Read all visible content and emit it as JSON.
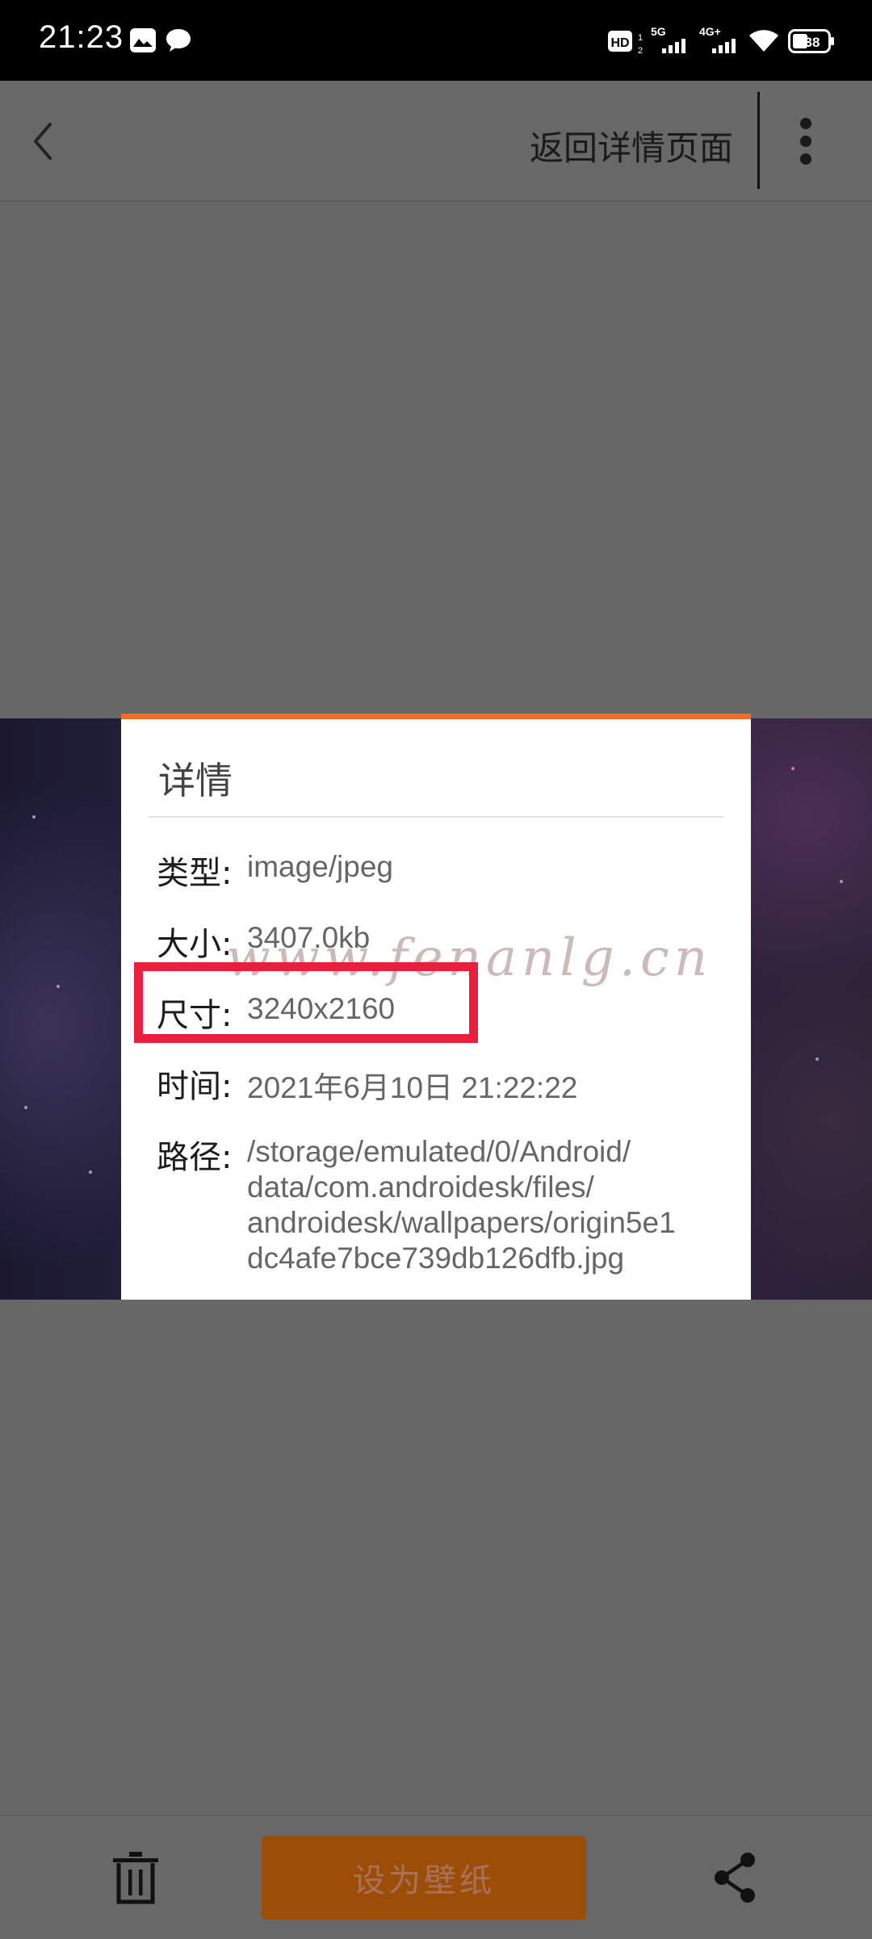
{
  "status_bar": {
    "time": "21:23",
    "left_icons": [
      "gallery-icon",
      "message-bubble-icon"
    ],
    "right_icons": [
      "hd-voice-icon",
      "signal-5g-icon",
      "signal-4g-icon",
      "wifi-icon",
      "battery-icon"
    ],
    "hd_label": "HD",
    "network_5g": "5G",
    "network_4g": "4G+",
    "battery_level": "38"
  },
  "top_bar": {
    "back_icon": "chevron-left-icon",
    "title": "返回详情页面",
    "more_icon": "more-vertical-icon"
  },
  "dialog": {
    "title": "详情",
    "rows": [
      {
        "label": "类型:",
        "value": "image/jpeg"
      },
      {
        "label": "大小:",
        "value": "3407.0kb"
      },
      {
        "label": "尺寸:",
        "value": "3240x2160"
      },
      {
        "label": "时间:",
        "value": "2021年6月10日 21:22:22"
      },
      {
        "label": "路径:",
        "value": "/storage/emulated/0/Android/data/com.androidesk/files/androidesk/wallpapers/origin5e1dc4afe7bce739db126dfb.jpg",
        "lines": [
          "/storage/emulated/0/Android/",
          "data/com.androidesk/files/",
          "androidesk/wallpapers/origin5e1",
          "dc4afe7bce739db126dfb.jpg"
        ]
      }
    ],
    "accent_color": "#e86f2e"
  },
  "watermark": "www.fenanlg.cn",
  "highlight_color": "#ea1f3d",
  "bottom_bar": {
    "delete_icon": "trash-icon",
    "set_wallpaper_label": "设为壁纸",
    "share_icon": "share-icon"
  }
}
